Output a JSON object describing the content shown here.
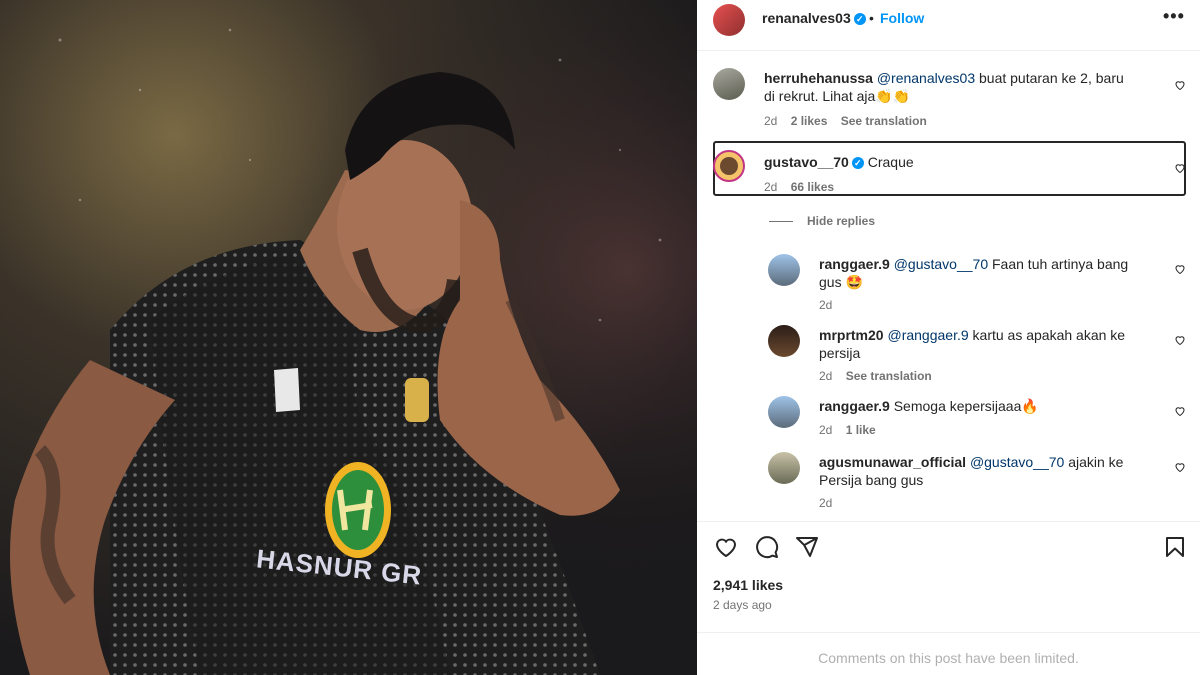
{
  "post": {
    "author": "renanalves03",
    "follow_label": "Follow",
    "dot": "•",
    "more": "•••",
    "likes": "2,941 likes",
    "time_ago": "2 days ago",
    "limited_notice": "Comments on this post have been limited."
  },
  "comments": [
    {
      "user": "herruhehanussa",
      "mention": "@renanalves03",
      "text": " buat putaran ke 2, baru di rekrut. Lihat aja👏👏",
      "time": "2d",
      "likes": "2 likes",
      "translate": "See translation"
    },
    {
      "user": "gustavo__70",
      "text": "Craque",
      "time": "2d",
      "likes": "66 likes"
    }
  ],
  "hide_replies_label": "Hide replies",
  "replies": [
    {
      "user": "ranggaer.9",
      "mention": "@gustavo__70",
      "text": " Faan tuh artinya bang gus 🤩",
      "time": "2d"
    },
    {
      "user": "mrprtm20",
      "mention": "@ranggaer.9",
      "text": " kartu as apakah akan ke persija",
      "time": "2d",
      "translate": "See translation"
    },
    {
      "user": "ranggaer.9",
      "text": "Semoga kepersijaaa🔥",
      "time": "2d",
      "likes": "1 like"
    },
    {
      "user": "agusmunawar_official",
      "mention": "@gustavo__70",
      "text": " ajakin ke Persija bang gus",
      "time": "2d"
    }
  ],
  "jersey": {
    "brand_text": "HASNUR GR"
  },
  "colors": {
    "link": "#0095f6",
    "mention": "#00376b",
    "muted": "#737373",
    "jersey_logo": "#f0b323"
  }
}
